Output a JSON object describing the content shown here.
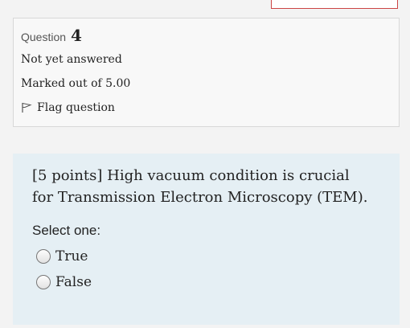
{
  "question": {
    "label": "Question",
    "number": "4",
    "state": "Not yet answered",
    "grade": "Marked out of 5.00",
    "flag_label": "Flag question"
  },
  "content": {
    "qtext_line1": "[5 points] High vacuum condition is crucial",
    "qtext_line2": "for Transmission Electron Microscopy (TEM).",
    "prompt": "Select one:",
    "options": [
      {
        "label": "True",
        "selected": false
      },
      {
        "label": "False",
        "selected": false
      }
    ]
  },
  "icons": {
    "flag": "flag-icon",
    "radio": "radio-icon"
  },
  "colors": {
    "info_background": "#f8f8f8",
    "content_background": "#e5eff4",
    "top_box_border": "#cc4444"
  }
}
